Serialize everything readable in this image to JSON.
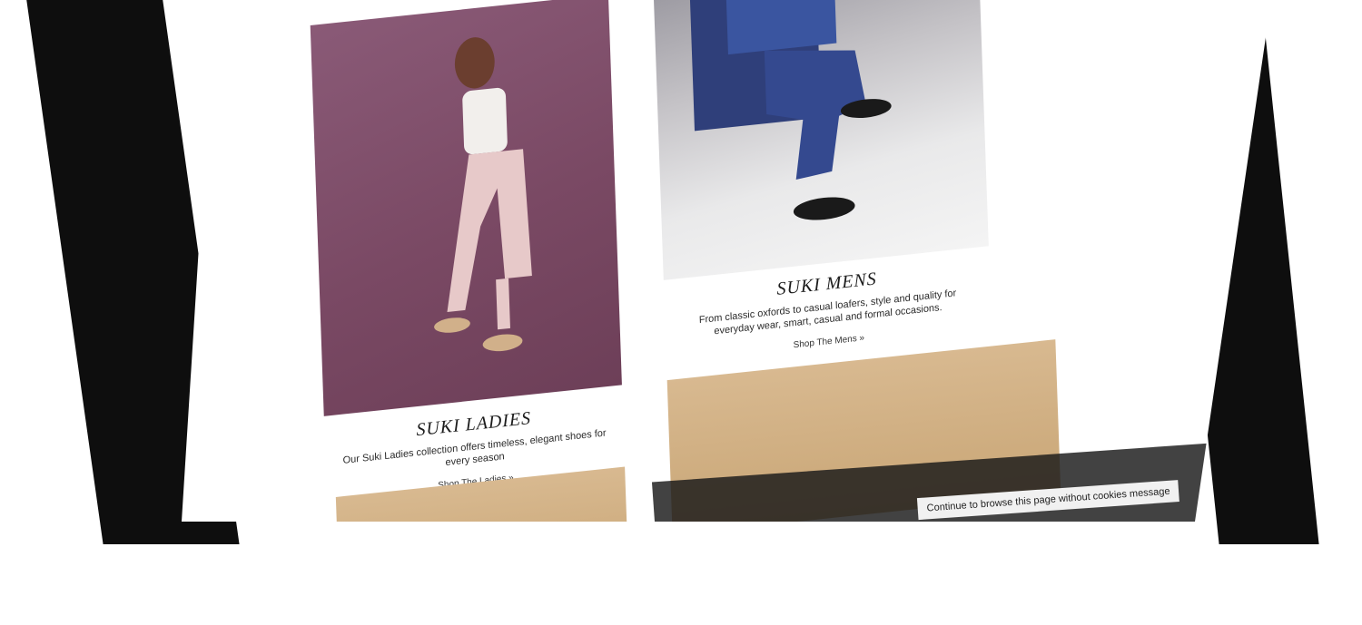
{
  "ladies": {
    "title": "SUKI LADIES",
    "description": "Our Suki Ladies collection offers timeless, elegant shoes for every season",
    "link": "Shop The Ladies »"
  },
  "mens": {
    "title": "SUKI MENS",
    "description": "From classic oxfords to casual loafers, style and quality for everyday wear, smart, casual and formal occasions.",
    "link": "Shop The Mens »"
  },
  "cookie": {
    "message": "Continue to browse this page without cookies message"
  },
  "colors": {
    "ladies_bg": "#7a4964",
    "mens_bg": "#c4c2c6",
    "promo": "#c9a676",
    "bezel": "#0e0e0e"
  }
}
